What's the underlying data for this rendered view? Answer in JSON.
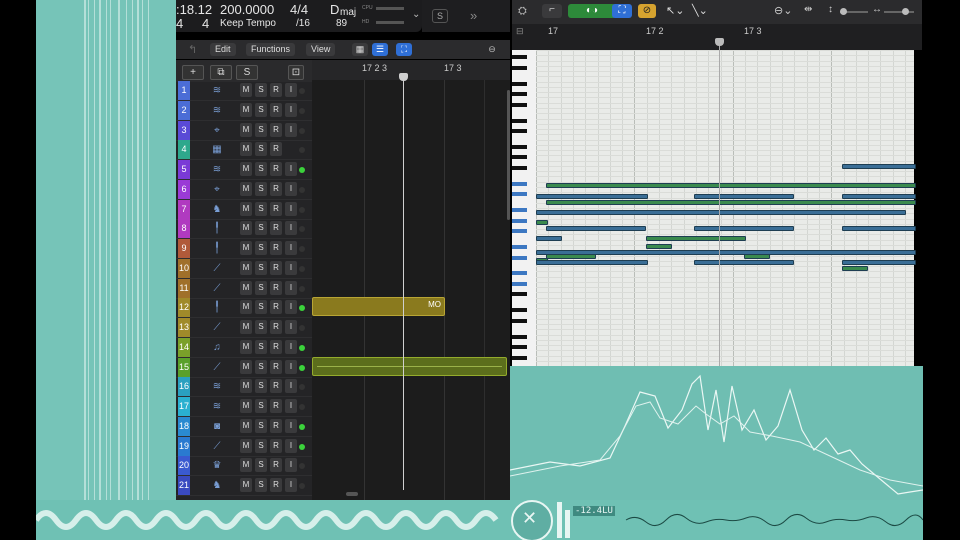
{
  "lcd": {
    "time": ":18.12",
    "tempo": "200.0000",
    "signature": "4/4",
    "key_root": "D",
    "key_mode": "maj",
    "bar": "4",
    "beat": "4",
    "tempo_mode": "Keep Tempo",
    "division": "/16",
    "value": "89",
    "cpu_label": "CPU",
    "hd_label": "HD"
  },
  "control_bar": {
    "solo_label": "S",
    "chevron": "»"
  },
  "tracks_toolbar": {
    "edit": "Edit",
    "functions": "Functions",
    "view": "View"
  },
  "header_buttons": {
    "add": "+",
    "duplicate": "⧉",
    "solo": "S"
  },
  "ruler": {
    "mark_a": "17 2 3",
    "mark_b": "17 3"
  },
  "piano_ruler": {
    "mark_a": "17",
    "mark_b": "17 2",
    "mark_c": "17 3"
  },
  "track_buttons": {
    "mute": "M",
    "solo": "S",
    "record": "R",
    "input": "I"
  },
  "tracks": [
    {
      "num": "1",
      "color": "#4b6dd6",
      "icon": "waveform-icon",
      "glyph": "≋",
      "rec": true,
      "inp": true,
      "dot": "#333"
    },
    {
      "num": "2",
      "color": "#4b6dd6",
      "icon": "waveform-icon",
      "glyph": "≋",
      "rec": true,
      "inp": true,
      "dot": "#333"
    },
    {
      "num": "3",
      "color": "#5a4ad6",
      "icon": "drum-kit-icon",
      "glyph": "⌖",
      "rec": true,
      "inp": true,
      "dot": "#333"
    },
    {
      "num": "4",
      "color": "#2ea88c",
      "icon": "pattern-icon",
      "glyph": "▦",
      "rec": true,
      "inp": false,
      "dot": "#333"
    },
    {
      "num": "5",
      "color": "#7a3ad6",
      "icon": "waveform-icon",
      "glyph": "≋",
      "rec": true,
      "inp": true,
      "dot": "#3bd23b"
    },
    {
      "num": "6",
      "color": "#9a3ad6",
      "icon": "drum-kit-icon",
      "glyph": "⌖",
      "rec": true,
      "inp": true,
      "dot": "#333"
    },
    {
      "num": "7",
      "color": "#b03ac0",
      "icon": "drummer-icon",
      "glyph": "♞",
      "rec": true,
      "inp": true,
      "dot": "#333"
    },
    {
      "num": "8",
      "color": "#b03ac0",
      "icon": "microphone-icon",
      "glyph": "╿",
      "rec": true,
      "inp": true,
      "dot": "#333"
    },
    {
      "num": "9",
      "color": "#b05a3a",
      "icon": "microphone-icon",
      "glyph": "╿",
      "rec": true,
      "inp": true,
      "dot": "#333"
    },
    {
      "num": "10",
      "color": "#a0702a",
      "icon": "drumstick-icon",
      "glyph": "⟋",
      "rec": true,
      "inp": true,
      "dot": "#333"
    },
    {
      "num": "11",
      "color": "#a0702a",
      "icon": "drumstick-icon",
      "glyph": "⟋",
      "rec": true,
      "inp": true,
      "dot": "#333"
    },
    {
      "num": "12",
      "color": "#a08a2a",
      "icon": "microphone-icon",
      "glyph": "╿",
      "rec": true,
      "inp": true,
      "dot": "#3bd23b"
    },
    {
      "num": "13",
      "color": "#a08a2a",
      "icon": "drumstick-icon",
      "glyph": "⟋",
      "rec": true,
      "inp": true,
      "dot": "#333"
    },
    {
      "num": "14",
      "color": "#7aa02a",
      "icon": "guitar-icon",
      "glyph": "♫",
      "rec": true,
      "inp": true,
      "dot": "#3bd23b"
    },
    {
      "num": "15",
      "color": "#5aa02a",
      "icon": "drumstick-icon",
      "glyph": "⟋",
      "rec": true,
      "inp": true,
      "dot": "#3bd23b"
    },
    {
      "num": "16",
      "color": "#2aa0c0",
      "icon": "waveform-icon",
      "glyph": "≋",
      "rec": true,
      "inp": true,
      "dot": "#333"
    },
    {
      "num": "17",
      "color": "#2ab0d0",
      "icon": "waveform-icon",
      "glyph": "≋",
      "rec": true,
      "inp": true,
      "dot": "#333"
    },
    {
      "num": "18",
      "color": "#2a8ad0",
      "icon": "amp-icon",
      "glyph": "◙",
      "rec": true,
      "inp": true,
      "dot": "#3bd23b"
    },
    {
      "num": "19",
      "color": "#2a7ad0",
      "icon": "drumstick-icon",
      "glyph": "⟋",
      "rec": true,
      "inp": true,
      "dot": "#3bd23b"
    },
    {
      "num": "20",
      "color": "#3a5ad0",
      "icon": "drum-kit-icon",
      "glyph": "♛",
      "rec": true,
      "inp": true,
      "dot": "#333"
    },
    {
      "num": "21",
      "color": "#3a4ac0",
      "icon": "drummer-icon",
      "glyph": "♞",
      "rec": true,
      "inp": true,
      "dot": "#333"
    }
  ],
  "regions": {
    "region_12_label": "MO"
  },
  "meter": {
    "loudness": "-12.4LU"
  },
  "colors": {
    "teal": "#76c4b8",
    "region_yellow": "#8a7a1e",
    "region_green": "#5c6e1c",
    "note_blue": "#3a6e96",
    "note_green": "#3a8a4e"
  }
}
